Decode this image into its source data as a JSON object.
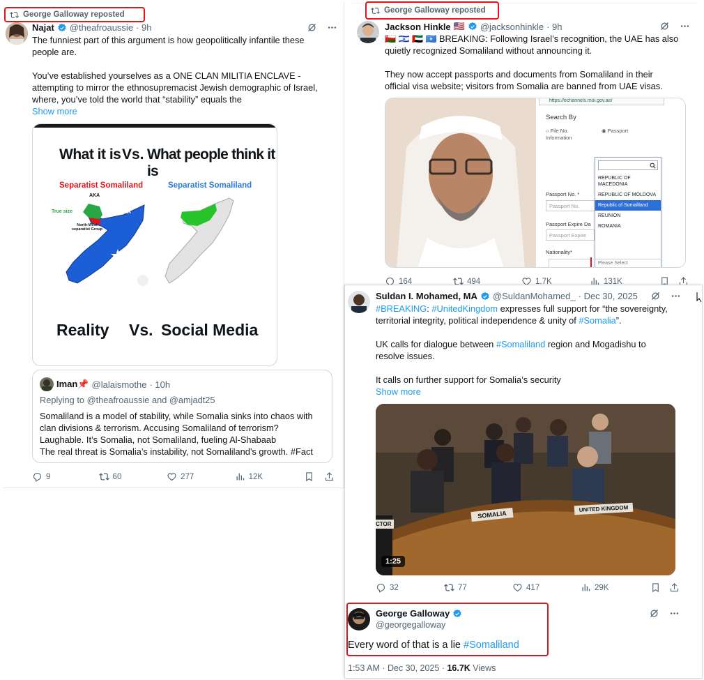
{
  "panel1": {
    "repost_label": "George Galloway reposted",
    "author": {
      "name": "Najat",
      "handle": "@theafroaussie",
      "time": "· 9h"
    },
    "lines": [
      "The funniest part of this argument is how geopolitically infantile these",
      "people are.",
      "",
      "You’ve established yourselves as a ONE CLAN MILITIA ENCLAVE -",
      "attempting to mirror the ethnosupremacist Jewish demographic of Israel,",
      "where, you’ve told the world that “stability” equals the"
    ],
    "show_more": "Show more",
    "meme": {
      "top_left": "What it is",
      "top_vs": "Vs.",
      "top_right": "What people think it is",
      "left_map_label": "Separatist Somaliland",
      "right_map_label": "Separatist Somaliland",
      "aka": "AKA",
      "true_size": "True size",
      "somalia": "SOMALIA",
      "nw_group": "North-West separatist Group",
      "bottom_left": "Reality",
      "bottom_vs": "Vs.",
      "bottom_right": "Social Media"
    },
    "quote": {
      "name": "Iman📌",
      "handle": "@lalaismothe",
      "time": "· 10h",
      "replying": "Replying to @theafroaussie and @amjadt25",
      "lines": [
        "Somaliland is a model of stability, while Somalia sinks into chaos with",
        "clan divisions & terrorism. Accusing Somaliland of terrorism?",
        "Laughable. It’s Somalia, not Somaliland, fueling Al-Shabaab",
        "The real threat is Somalia’s instability, not Somaliland’s growth. #Fact"
      ]
    },
    "stats": {
      "replies": "9",
      "reposts": "60",
      "likes": "277",
      "views": "12K"
    }
  },
  "panel2": {
    "repost_label": "George Galloway reposted",
    "author": {
      "name": "Jackson Hinkle",
      "flag": "🇺🇸",
      "handle": "@jacksonhinkle",
      "time": "· 9h"
    },
    "flags": "🇴🇲 🇮🇱 🇦🇪 🇸🇴",
    "lines": [
      "BREAKING: Following Israel’s recognition, the UAE has also",
      "quietly recognized Somaliland without announcing it.",
      "",
      "They now accept passports and documents from Somaliland in their",
      "official visa website; visitors from Somalia are banned from UAE visas."
    ],
    "form": {
      "url": "https://echannels.moi.gov.ae/",
      "search_by": "Search By",
      "opt_file": "File No. Information",
      "opt_passport": "Passport",
      "passport_no": "Passport No. *",
      "passport_ph": "Passport No.",
      "expire": "Passport Expire Da",
      "expire_ph": "Passport Expire",
      "nationality": "Nationality*",
      "please_select": "Please Select",
      "dropdown": [
        "REPUBLIC OF MACEDONIA",
        "REPUBLIC OF MOLDOVA",
        "Republic of Somaliland",
        "REUNION",
        "ROMANIA"
      ]
    },
    "stats": {
      "replies": "164",
      "reposts": "494",
      "likes": "1.7K",
      "views": "131K"
    }
  },
  "panel3": {
    "author": {
      "name": "Suldan I. Mohamed, MA",
      "handle": "@SuldanMohamed_",
      "time": "· Dec 30, 2025"
    },
    "line1_a": "#BREAKING",
    "line1_b": ": ",
    "line1_c": "#UnitedKingdom",
    "line1_d": " expresses full support for “the sovereignty,",
    "line2_a": "territorial integrity, political independence & unity of ",
    "line2_b": "#Somalia",
    "line2_c": "”.",
    "line3_a": "UK calls for dialogue between ",
    "line3_b": "#Somaliland",
    "line3_c": " region and Mogadishu to",
    "line4": "resolve issues.",
    "line5": "It calls on further support for Somalia’s security",
    "show_more": "Show more",
    "video": {
      "duration": "1:25",
      "placard_somalia": "SOMALIA",
      "placard_uk": "UNITED KINGDOM",
      "placard_ctor": "CTOR"
    },
    "stats": {
      "replies": "32",
      "reposts": "77",
      "likes": "417",
      "views": "29K"
    },
    "reply": {
      "name": "George Galloway",
      "handle": "@georgegalloway",
      "text": "Every word of that is a lie ",
      "hashtag": "#Somaliland"
    },
    "footer": {
      "time": "1:53 AM · Dec 30, 2025 · ",
      "views_count": "16.7K",
      "views_label": " Views"
    }
  },
  "colors": {
    "accent": "#1d9bf0",
    "highlight": "#e0141b",
    "muted": "#536471"
  }
}
